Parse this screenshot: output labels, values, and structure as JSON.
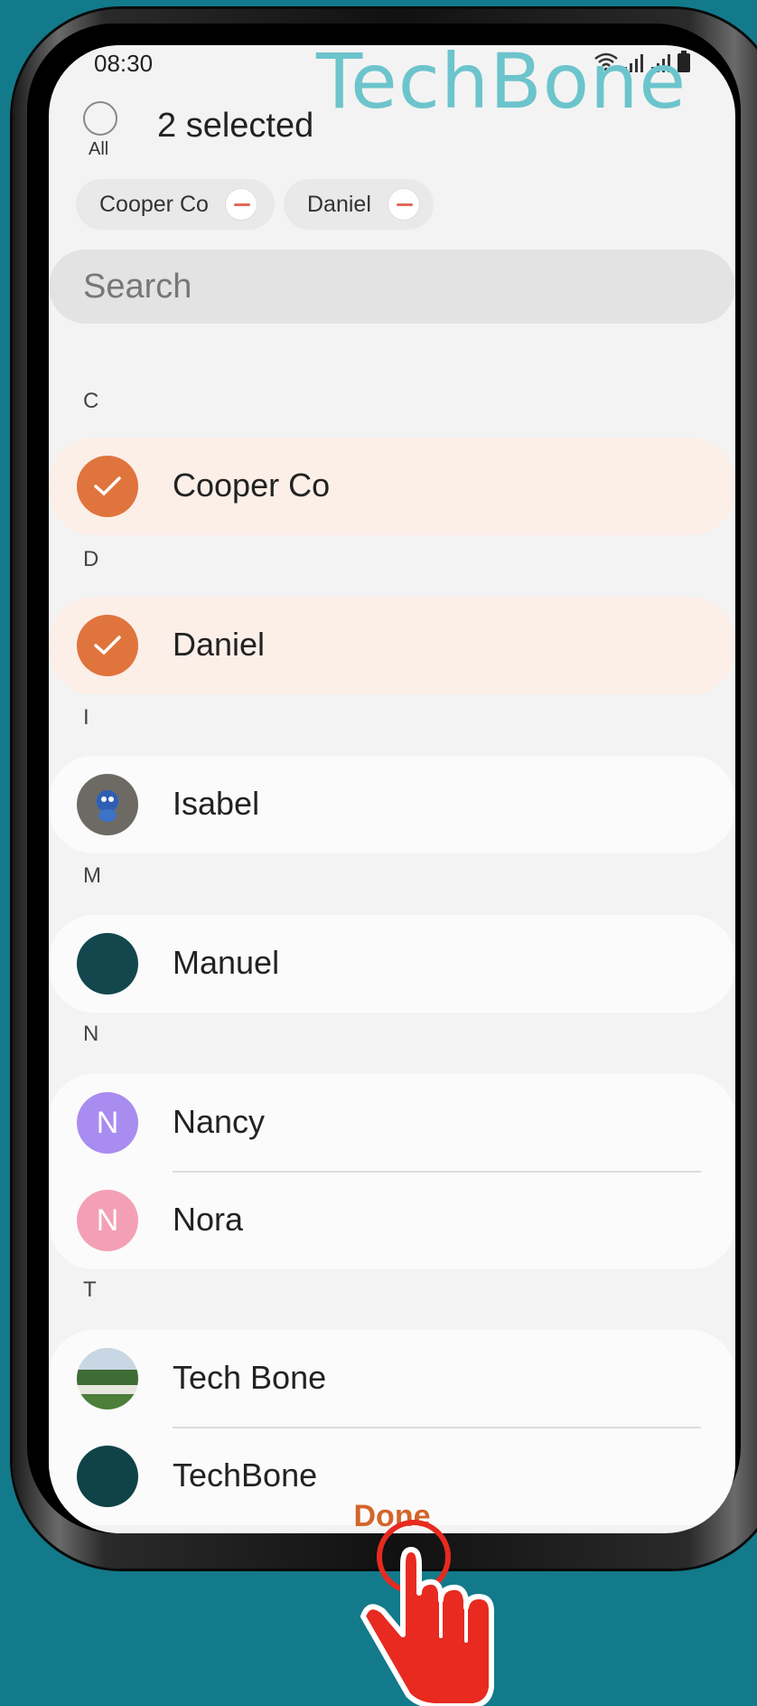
{
  "status": {
    "time": "08:30"
  },
  "watermark": "TechBone",
  "header": {
    "all_label": "All",
    "selected_count": "2 selected"
  },
  "chips": [
    {
      "label": "Cooper Co"
    },
    {
      "label": "Daniel"
    }
  ],
  "search": {
    "placeholder": "Search"
  },
  "sections": [
    {
      "letter": "C",
      "contacts": [
        {
          "name": "Cooper Co",
          "selected": true,
          "avatar": "checked"
        }
      ]
    },
    {
      "letter": "D",
      "contacts": [
        {
          "name": "Daniel",
          "selected": true,
          "avatar": "checked"
        }
      ]
    },
    {
      "letter": "I",
      "contacts": [
        {
          "name": "Isabel",
          "selected": false,
          "avatar": "photo"
        }
      ]
    },
    {
      "letter": "M",
      "contacts": [
        {
          "name": "Manuel",
          "selected": false,
          "avatar": "photo"
        }
      ]
    },
    {
      "letter": "N",
      "contacts": [
        {
          "name": "Nancy",
          "selected": false,
          "avatar": "letter",
          "initial": "N",
          "color": "#a98cf0"
        },
        {
          "name": "Nora",
          "selected": false,
          "avatar": "letter",
          "initial": "N",
          "color": "#f3a0b6"
        }
      ]
    },
    {
      "letter": "T",
      "contacts": [
        {
          "name": "Tech Bone",
          "selected": false,
          "avatar": "photo"
        },
        {
          "name": "TechBone",
          "selected": false,
          "avatar": "photo"
        }
      ]
    }
  ],
  "footer": {
    "done_label": "Done"
  },
  "colors": {
    "accent": "#d3652a",
    "selected_row": "#fcefe8",
    "background": "#127a8a"
  }
}
